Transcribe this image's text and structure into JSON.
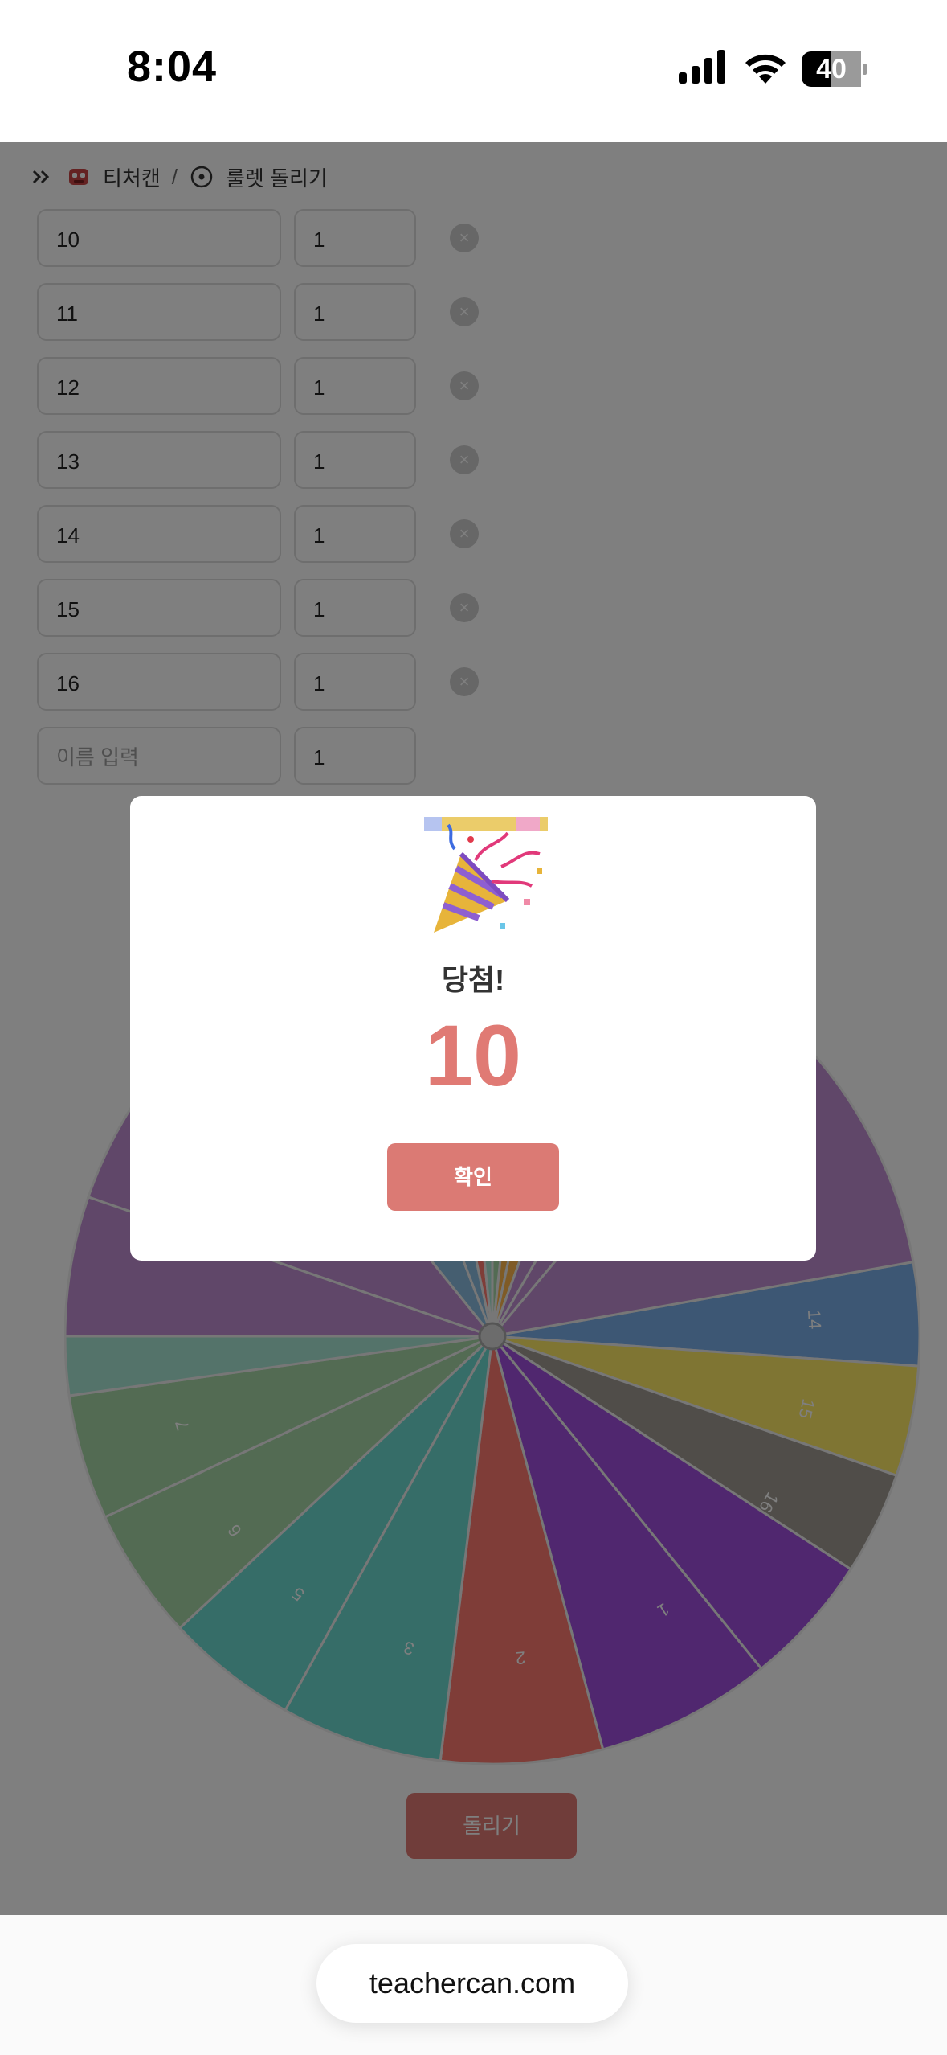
{
  "status_bar": {
    "time": "8:04",
    "battery": "40"
  },
  "breadcrumb": {
    "site": "티처캔",
    "separator": "/",
    "page": "룰렛 돌리기"
  },
  "rows": [
    {
      "name": "10",
      "weight": "1"
    },
    {
      "name": "11",
      "weight": "1"
    },
    {
      "name": "12",
      "weight": "1"
    },
    {
      "name": "13",
      "weight": "1"
    },
    {
      "name": "14",
      "weight": "1"
    },
    {
      "name": "15",
      "weight": "1"
    },
    {
      "name": "16",
      "weight": "1"
    }
  ],
  "new_row": {
    "placeholder": "이름 입력",
    "weight": "1"
  },
  "remove_icon": "×",
  "wheel": {
    "labels": [
      "14",
      "15",
      "16",
      "1",
      "2",
      "3",
      "5",
      "6",
      "7"
    ],
    "colors": {
      "purple": "#b68ad0",
      "blue": "#7aaee9",
      "yellow": "#ffeb67",
      "taupe": "#a19a92",
      "violet": "#a04ede",
      "red": "#ff7a71",
      "teal": "#6cdbd1",
      "sage": "#a6d6a6",
      "mint": "#a9e7d4",
      "lilac": "#c18ed2",
      "slate": "#8abde0",
      "orange": "#ffb74d"
    }
  },
  "spin_button": {
    "label": "돌리기"
  },
  "modal": {
    "emoji": "🎉",
    "title": "당첨!",
    "winner": "10",
    "confirm_label": "확인"
  },
  "browser": {
    "url": "teachercan.com"
  },
  "theme": {
    "accent": "#e07a74"
  }
}
